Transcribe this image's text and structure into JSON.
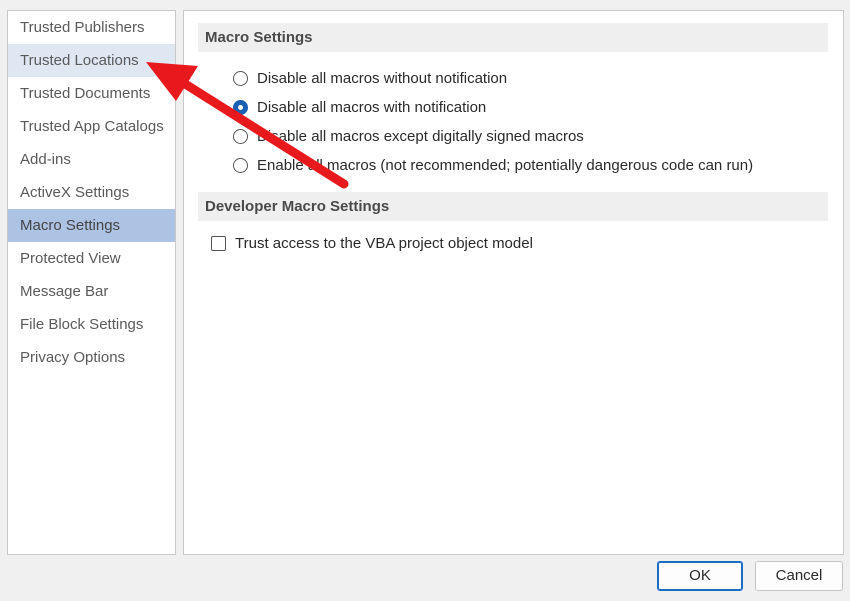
{
  "sidebar": {
    "items": [
      {
        "label": "Trusted Publishers"
      },
      {
        "label": "Trusted Locations"
      },
      {
        "label": "Trusted Documents"
      },
      {
        "label": "Trusted App Catalogs"
      },
      {
        "label": "Add-ins"
      },
      {
        "label": "ActiveX Settings"
      },
      {
        "label": "Macro Settings"
      },
      {
        "label": "Protected View"
      },
      {
        "label": "Message Bar"
      },
      {
        "label": "File Block Settings"
      },
      {
        "label": "Privacy Options"
      }
    ],
    "selected": "Macro Settings",
    "highlighted": "Trusted Locations"
  },
  "macro_settings": {
    "header": "Macro Settings",
    "options": [
      {
        "label": "Disable all macros without notification",
        "checked": false
      },
      {
        "label": "Disable all macros with notification",
        "checked": true
      },
      {
        "label": "Disable all macros except digitally signed macros",
        "checked": false
      },
      {
        "label": "Enable all macros (not recommended; potentially dangerous code can run)",
        "checked": false
      }
    ]
  },
  "developer_settings": {
    "header": "Developer Macro Settings",
    "trust_vba_label": "Trust access to the VBA project object model",
    "trust_vba_checked": false
  },
  "buttons": {
    "ok": "OK",
    "cancel": "Cancel"
  },
  "colors": {
    "selected_bg": "#adc3e4",
    "hover_bg": "#dfe7f3",
    "accent": "#1a5fb4",
    "annotation_arrow": "#e8191c"
  }
}
